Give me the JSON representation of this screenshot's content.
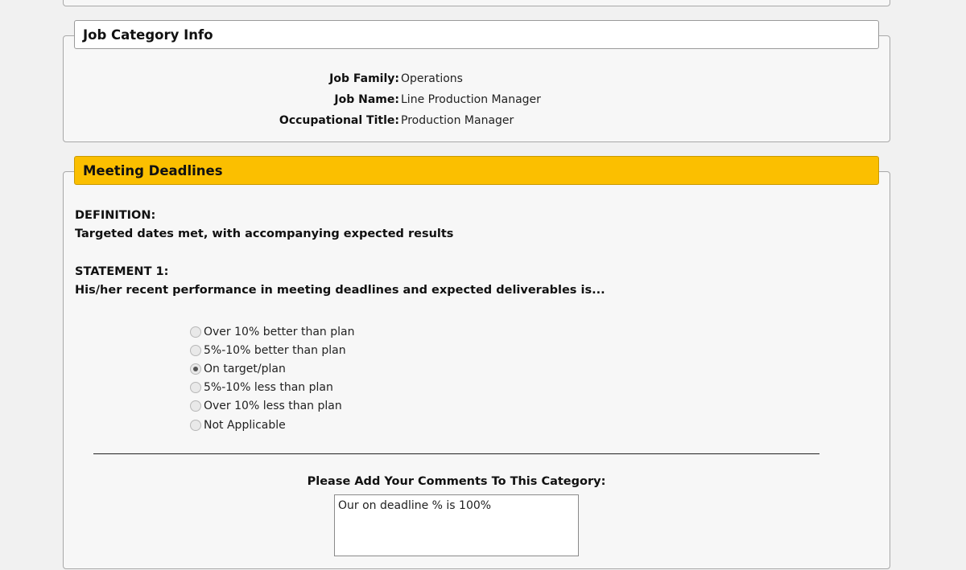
{
  "job_category": {
    "title": "Job Category Info",
    "fields": [
      {
        "label": "Job Family:",
        "value": "Operations"
      },
      {
        "label": "Job Name:",
        "value": "Line Production Manager"
      },
      {
        "label": "Occupational Title:",
        "value": "Production Manager"
      }
    ]
  },
  "meeting_deadlines": {
    "title": "Meeting Deadlines",
    "definition_heading": "DEFINITION:",
    "definition_text": "Targeted dates met, with accompanying expected results",
    "statement_heading": "STATEMENT 1:",
    "statement_text": "His/her recent performance in meeting deadlines and expected deliverables is...",
    "options": [
      {
        "label": "Over 10% better than plan",
        "checked": false
      },
      {
        "label": "5%-10% better than plan",
        "checked": false
      },
      {
        "label": "On target/plan",
        "checked": true
      },
      {
        "label": "5%-10% less than plan",
        "checked": false
      },
      {
        "label": "Over 10% less than plan",
        "checked": false
      },
      {
        "label": "Not Applicable",
        "checked": false
      }
    ],
    "comments_label": "Please Add Your Comments To This Category:",
    "comments_value": "Our on deadline % is 100%"
  },
  "colors": {
    "section_header_accent": "#fbbf00",
    "page_background": "#f1f1f1"
  }
}
